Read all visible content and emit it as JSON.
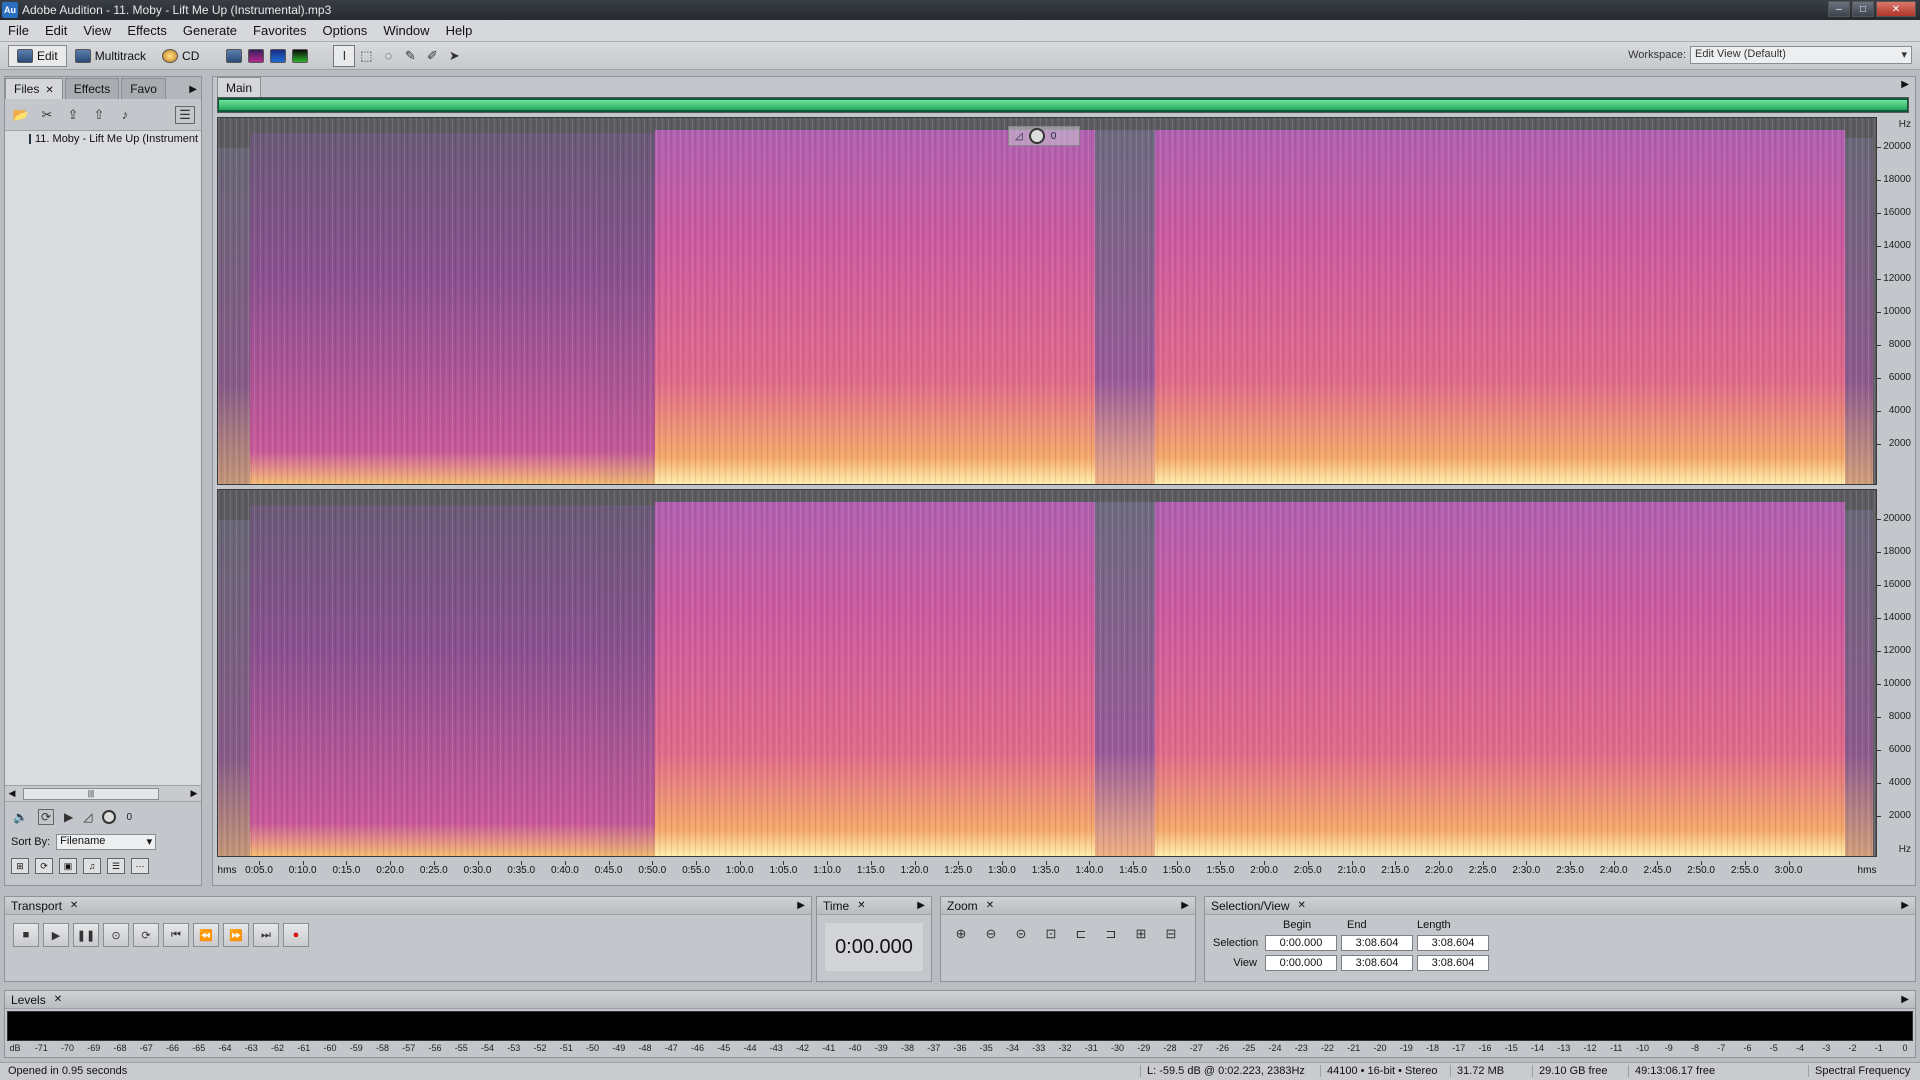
{
  "window": {
    "title": "Adobe Audition - 11. Moby - Lift Me Up (Instrumental).mp3",
    "app_icon": "Au"
  },
  "menu": [
    "File",
    "Edit",
    "View",
    "Effects",
    "Generate",
    "Favorites",
    "Options",
    "Window",
    "Help"
  ],
  "toolbar": {
    "edit_label": "Edit",
    "multitrack_label": "Multitrack",
    "cd_label": "CD",
    "workspace_label": "Workspace:",
    "workspace_value": "Edit View (Default)"
  },
  "left_panel": {
    "tabs": [
      "Files",
      "Effects",
      "Favo"
    ],
    "file_item": "11. Moby - Lift Me Up (Instrument",
    "sort_label": "Sort By:",
    "sort_value": "Filename",
    "volume_value": "0"
  },
  "main": {
    "tab_label": "Main",
    "gain_value": "0",
    "hz_unit": "Hz",
    "hz_ticks": [
      "20000",
      "18000",
      "16000",
      "14000",
      "12000",
      "10000",
      "8000",
      "6000",
      "4000",
      "2000"
    ],
    "time_start_label": "hms",
    "time_end_label": "hms",
    "time_ticks": [
      "0:05.0",
      "0:10.0",
      "0:15.0",
      "0:20.0",
      "0:25.0",
      "0:30.0",
      "0:35.0",
      "0:40.0",
      "0:45.0",
      "0:50.0",
      "0:55.0",
      "1:00.0",
      "1:05.0",
      "1:10.0",
      "1:15.0",
      "1:20.0",
      "1:25.0",
      "1:30.0",
      "1:35.0",
      "1:40.0",
      "1:45.0",
      "1:50.0",
      "1:55.0",
      "2:00.0",
      "2:05.0",
      "2:10.0",
      "2:15.0",
      "2:20.0",
      "2:25.0",
      "2:30.0",
      "2:35.0",
      "2:40.0",
      "2:45.0",
      "2:50.0",
      "2:55.0",
      "3:00.0"
    ]
  },
  "transport": {
    "label": "Transport"
  },
  "time_panel": {
    "label": "Time",
    "value": "0:00.000"
  },
  "zoom_panel": {
    "label": "Zoom"
  },
  "selection_panel": {
    "label": "Selection/View",
    "col_begin": "Begin",
    "col_end": "End",
    "col_length": "Length",
    "row_selection": "Selection",
    "row_view": "View",
    "selection_begin": "0:00.000",
    "selection_end": "3:08.604",
    "selection_length": "3:08.604",
    "view_begin": "0:00.000",
    "view_end": "3:08.604",
    "view_length": "3:08.604"
  },
  "levels": {
    "label": "Levels",
    "db_ticks": [
      "dB",
      "-71",
      "-70",
      "-69",
      "-68",
      "-67",
      "-66",
      "-65",
      "-64",
      "-63",
      "-62",
      "-61",
      "-60",
      "-59",
      "-58",
      "-57",
      "-56",
      "-55",
      "-54",
      "-53",
      "-52",
      "-51",
      "-50",
      "-49",
      "-48",
      "-47",
      "-46",
      "-45",
      "-44",
      "-43",
      "-42",
      "-41",
      "-40",
      "-39",
      "-38",
      "-37",
      "-36",
      "-35",
      "-34",
      "-33",
      "-32",
      "-31",
      "-30",
      "-29",
      "-28",
      "-27",
      "-26",
      "-25",
      "-24",
      "-23",
      "-22",
      "-21",
      "-20",
      "-19",
      "-18",
      "-17",
      "-16",
      "-15",
      "-14",
      "-13",
      "-12",
      "-11",
      "-10",
      "-9",
      "-8",
      "-7",
      "-6",
      "-5",
      "-4",
      "-3",
      "-2",
      "-1",
      "0"
    ]
  },
  "status": {
    "opened": "Opened in 0.95 seconds",
    "cursor": "L: -59.5 dB @  0:02.223, 2383Hz",
    "format": "44100 • 16-bit • Stereo",
    "size": "31.72 MB",
    "disk": "29.10 GB free",
    "time_free": "49:13:06.17 free",
    "view_mode": "Spectral Frequency"
  },
  "colors": {
    "spectrum_low": "#5b5b60",
    "spectrum_mid": "#c85aa0",
    "spectrum_high": "#f0d890",
    "overview": "#2fb46a"
  }
}
